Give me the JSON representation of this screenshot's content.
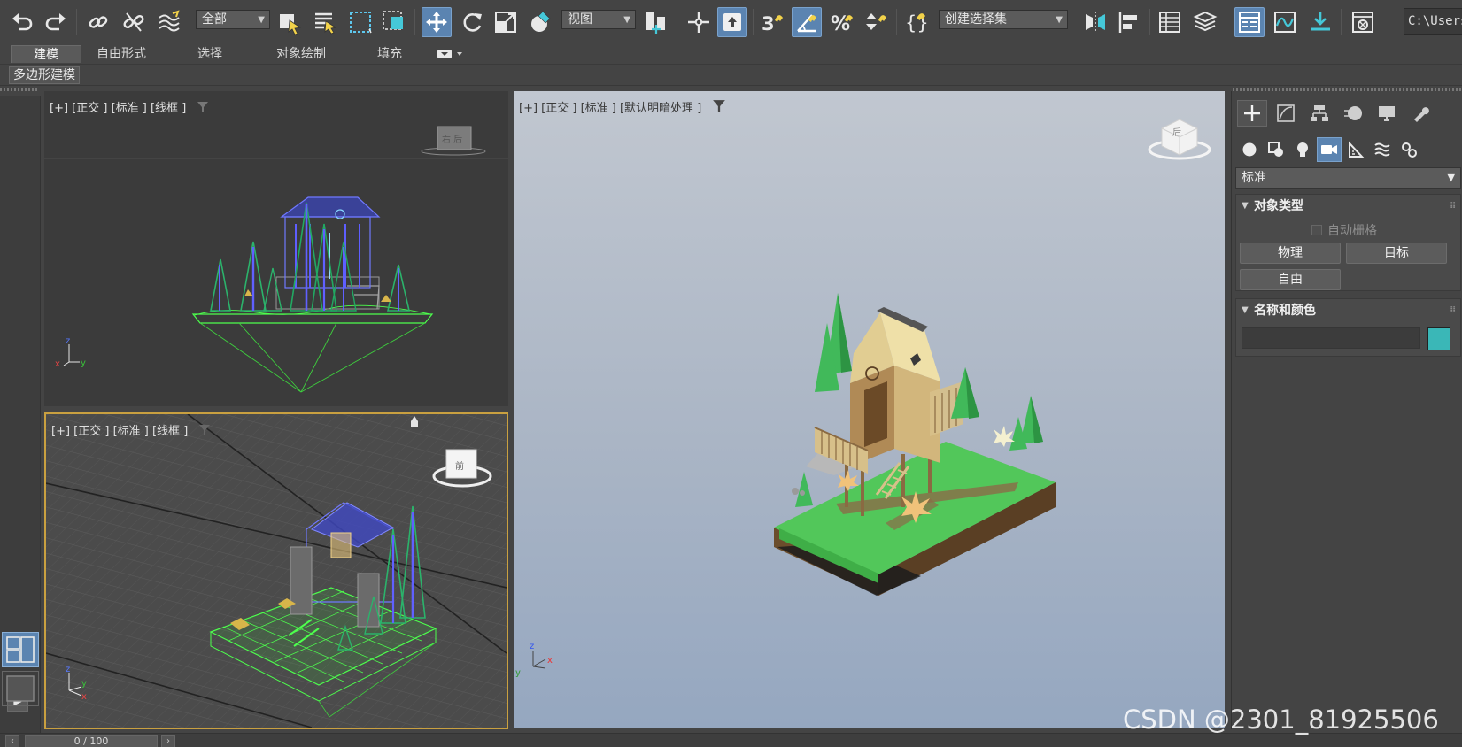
{
  "toolbar": {
    "selection_filter": "全部",
    "reference_coord": "视图",
    "named_selection": "创建选择集",
    "path": "C:\\Users"
  },
  "ribbon": {
    "tabs": [
      {
        "label": "建模",
        "active": true
      },
      {
        "label": "自由形式",
        "active": false
      },
      {
        "label": "选择",
        "active": false
      },
      {
        "label": "对象绘制",
        "active": false
      },
      {
        "label": "填充",
        "active": false
      }
    ],
    "subtab": "多边形建模"
  },
  "viewports": {
    "top": {
      "label": "[+] [正交 ] [标准 ] [线框 ]",
      "cube_text": "右 后"
    },
    "perspective": {
      "label": "[+] [正交 ] [标准 ] [线框 ]",
      "cube_text": "前"
    },
    "main": {
      "label": "[+] [正交 ] [标准 ] [默认明暗处理 ]",
      "cube_text": "后"
    }
  },
  "command_panel": {
    "dropdown": "标准",
    "object_type": {
      "title": "对象类型",
      "autogrid": "自动栅格",
      "buttons": [
        "物理",
        "目标",
        "自由"
      ]
    },
    "name_color": {
      "title": "名称和颜色",
      "name_value": "",
      "swatch_color": "#3ab7b7"
    }
  },
  "timeline": {
    "frame": "0 / 100"
  },
  "watermark": "CSDN @2301_81925506",
  "colors": {
    "accent": "#5b84b1",
    "active_viewport_border": "#c9a040"
  }
}
